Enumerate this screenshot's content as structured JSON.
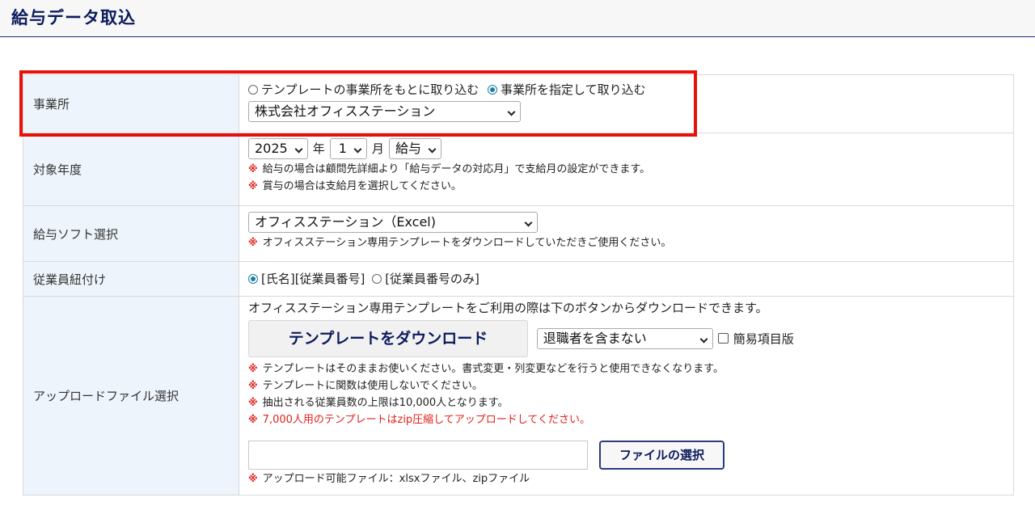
{
  "page_title": "給与データ取込",
  "office": {
    "label": "事業所",
    "radio_template_label": "テンプレートの事業所をもとに取り込む",
    "radio_specify_label": "事業所を指定して取り込む",
    "radio_selected": "specify",
    "office_select_value": "株式会社オフィスステーション"
  },
  "target_year": {
    "label": "対象年度",
    "year_value": "2025",
    "year_unit": "年",
    "month_value": "1",
    "month_unit": "月",
    "type_value": "給与",
    "note_mark": "※",
    "notes": [
      "給与の場合は顧問先詳細より「給与データの対応月」で支給月の設定ができます。",
      "賞与の場合は支給月を選択してください。"
    ]
  },
  "software": {
    "label": "給与ソフト選択",
    "select_value": "オフィスステーション（Excel)",
    "note": "オフィスステーション専用テンプレートをダウンロードしていただきご使用ください。"
  },
  "employee_link": {
    "label": "従業員紐付け",
    "option1_label": "[氏名][従業員番号]",
    "option2_label": "[従業員番号のみ]",
    "selected": "option1"
  },
  "upload": {
    "label": "アップロードファイル選択",
    "intro": "オフィスステーション専用テンプレートをご利用の際は下のボタンからダウンロードできます。",
    "download_button_label": "テンプレートをダウンロード",
    "retired_select_value": "退職者を含まない",
    "simple_checkbox_label": "簡易項目版",
    "notes": [
      "テンプレートはそのままお使いください。書式変更・列変更などを行うと使用できなくなります。",
      "テンプレートに関数は使用しないでください。",
      "抽出される従業員数の上限は10,000人となります。"
    ],
    "red_note": "7,000人用のテンプレートはzip圧縮してアップロードしてください。",
    "file_button_label": "ファイルの選択",
    "allowed_note": "アップロード可能ファイル：xlsxファイル、zipファイル"
  },
  "colors": {
    "title": "#0b1a5c",
    "label_bg": "#eef4fb",
    "highlight": "#e8100a",
    "warning": "#e0201a",
    "radio_accent": "#1a7fa6"
  }
}
